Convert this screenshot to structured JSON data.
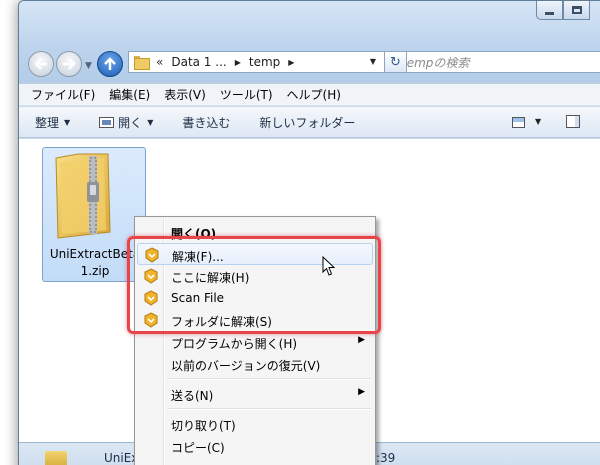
{
  "window": {
    "nav_back_icon": "back-arrow-icon",
    "nav_forward_icon": "forward-arrow-icon",
    "nav_up_icon": "up-arrow-icon",
    "caption_buttons": [
      "minimize-icon",
      "maximize-icon"
    ]
  },
  "address": {
    "chevrons": "«",
    "segments": [
      "Data 1 ...",
      "temp"
    ],
    "refresh_symbol": "↻",
    "search_placeholder": "tempの検索"
  },
  "menubar": {
    "items": [
      "ファイル(F)",
      "編集(E)",
      "表示(V)",
      "ツール(T)",
      "ヘルプ(H)"
    ]
  },
  "toolbar": {
    "organize": "整理",
    "open": "開く",
    "burn": "書き込む",
    "new_folder": "新しいフォルダー"
  },
  "file": {
    "name_line1": "UniExtractBeta",
    "name_line2": "1.zip"
  },
  "status": {
    "name": "UniEx",
    "time": ":39"
  },
  "context_menu": {
    "items": [
      {
        "label": "開く(O)",
        "bold": true
      },
      {
        "label": "解凍(F)...",
        "icon": "uniextract-icon"
      },
      {
        "label": "ここに解凍(H)",
        "icon": "uniextract-icon"
      },
      {
        "label": "Scan File",
        "icon": "uniextract-icon"
      },
      {
        "label": "フォルダに解凍(S)",
        "icon": "uniextract-icon"
      },
      {
        "label": "プログラムから開く(H)",
        "submenu": true
      },
      {
        "label": "以前のバージョンの復元(V)"
      },
      {
        "label": "送る(N)",
        "submenu": true
      },
      {
        "label": "切り取り(T)"
      },
      {
        "label": "コピー(C)"
      }
    ],
    "submenu_glyph": "▶"
  },
  "colors": {
    "highlight": "#e8454a",
    "selection": "#c2dcf8",
    "frame": "#c7dbf0"
  }
}
